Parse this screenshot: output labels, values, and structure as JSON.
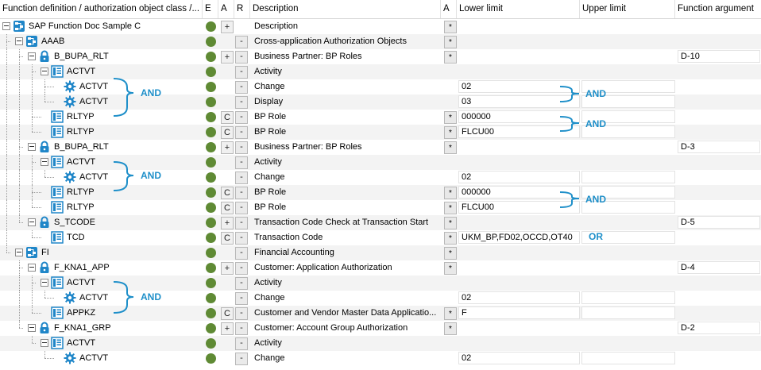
{
  "columns": {
    "function_definition": "Function definition / authorization object class /...",
    "e": "E",
    "a": "A",
    "r": "R",
    "description": "Description",
    "a2": "A",
    "lower_limit": "Lower limit",
    "upper_limit": "Upper limit",
    "function_argument": "Function argument"
  },
  "rows": [
    {
      "label": "SAP Function Doc Sample C",
      "icon": "function-doc-icon",
      "level": 0,
      "expand": true,
      "a": "+",
      "r": "",
      "desc": "Description",
      "star": true,
      "lower": null,
      "upper": null,
      "farg": null
    },
    {
      "label": "AAAB",
      "icon": "object-class-icon",
      "level": 1,
      "expand": true,
      "a": "",
      "r": "-",
      "desc": "Cross-application Authorization Objects",
      "star": true,
      "lower": null,
      "upper": null,
      "farg": null
    },
    {
      "label": "B_BUPA_RLT",
      "icon": "lock-icon",
      "level": 2,
      "expand": true,
      "a": "+",
      "r": "-",
      "desc": "Business Partner: BP Roles",
      "star": true,
      "lower": null,
      "upper": null,
      "farg": "D-10"
    },
    {
      "label": "ACTVT",
      "icon": "field-icon",
      "level": 3,
      "expand": true,
      "a": "",
      "r": "-",
      "desc": "Activity",
      "star": false,
      "lower": null,
      "upper": null,
      "farg": null
    },
    {
      "label": "ACTVT",
      "icon": "gear-icon",
      "level": 4,
      "expand": false,
      "a": "",
      "r": "-",
      "desc": "Change",
      "star": false,
      "lower": "02",
      "upper": "",
      "farg": null
    },
    {
      "label": "ACTVT",
      "icon": "gear-icon",
      "level": 4,
      "expand": false,
      "a": "",
      "r": "-",
      "desc": "Display",
      "star": false,
      "lower": "03",
      "upper": "",
      "farg": null
    },
    {
      "label": "RLTYP",
      "icon": "field-icon",
      "level": 3,
      "expand": false,
      "a": "C",
      "r": "-",
      "desc": "BP Role",
      "star": true,
      "lower": "000000",
      "upper": "",
      "farg": null
    },
    {
      "label": "RLTYP",
      "icon": "field-icon",
      "level": 3,
      "expand": false,
      "a": "C",
      "r": "-",
      "desc": "BP Role",
      "star": true,
      "lower": "FLCU00",
      "upper": "",
      "farg": null
    },
    {
      "label": "B_BUPA_RLT",
      "icon": "lock-icon",
      "level": 2,
      "expand": true,
      "a": "+",
      "r": "-",
      "desc": "Business Partner: BP Roles",
      "star": true,
      "lower": null,
      "upper": null,
      "farg": "D-3"
    },
    {
      "label": "ACTVT",
      "icon": "field-icon",
      "level": 3,
      "expand": true,
      "a": "",
      "r": "-",
      "desc": "Activity",
      "star": false,
      "lower": null,
      "upper": null,
      "farg": null
    },
    {
      "label": "ACTVT",
      "icon": "gear-icon",
      "level": 4,
      "expand": false,
      "a": "",
      "r": "-",
      "desc": "Change",
      "star": false,
      "lower": "02",
      "upper": "",
      "farg": null
    },
    {
      "label": "RLTYP",
      "icon": "field-icon",
      "level": 3,
      "expand": false,
      "a": "C",
      "r": "-",
      "desc": "BP Role",
      "star": true,
      "lower": "000000",
      "upper": "",
      "farg": null
    },
    {
      "label": "RLTYP",
      "icon": "field-icon",
      "level": 3,
      "expand": false,
      "a": "C",
      "r": "-",
      "desc": "BP Role",
      "star": true,
      "lower": "FLCU00",
      "upper": "",
      "farg": null
    },
    {
      "label": "S_TCODE",
      "icon": "lock-icon",
      "level": 2,
      "expand": true,
      "a": "+",
      "r": "-",
      "desc": "Transaction Code Check at Transaction Start",
      "star": true,
      "lower": null,
      "upper": null,
      "farg": "D-5"
    },
    {
      "label": "TCD",
      "icon": "field-icon",
      "level": 3,
      "expand": false,
      "a": "C",
      "r": "-",
      "desc": "Transaction Code",
      "star": true,
      "lower": "UKM_BP,FD02,OCCD,OT40",
      "upper": "",
      "farg": null
    },
    {
      "label": "FI",
      "icon": "object-class-icon",
      "level": 1,
      "expand": true,
      "a": "",
      "r": "-",
      "desc": "Financial Accounting",
      "star": true,
      "lower": null,
      "upper": null,
      "farg": null
    },
    {
      "label": "F_KNA1_APP",
      "icon": "lock-icon",
      "level": 2,
      "expand": true,
      "a": "+",
      "r": "-",
      "desc": "Customer: Application Authorization",
      "star": true,
      "lower": null,
      "upper": null,
      "farg": "D-4"
    },
    {
      "label": "ACTVT",
      "icon": "field-icon",
      "level": 3,
      "expand": true,
      "a": "",
      "r": "-",
      "desc": "Activity",
      "star": false,
      "lower": null,
      "upper": null,
      "farg": null
    },
    {
      "label": "ACTVT",
      "icon": "gear-icon",
      "level": 4,
      "expand": false,
      "a": "",
      "r": "-",
      "desc": "Change",
      "star": false,
      "lower": "02",
      "upper": "",
      "farg": null
    },
    {
      "label": "APPKZ",
      "icon": "field-icon",
      "level": 3,
      "expand": false,
      "a": "C",
      "r": "-",
      "desc": "Customer and Vendor Master Data Applicatio...",
      "star": true,
      "lower": "F",
      "upper": "",
      "farg": null
    },
    {
      "label": "F_KNA1_GRP",
      "icon": "lock-icon",
      "level": 2,
      "expand": true,
      "a": "+",
      "r": "-",
      "desc": "Customer: Account Group Authorization",
      "star": true,
      "lower": null,
      "upper": null,
      "farg": "D-2"
    },
    {
      "label": "ACTVT",
      "icon": "field-icon",
      "level": 3,
      "expand": true,
      "a": "",
      "r": "-",
      "desc": "Activity",
      "star": false,
      "lower": null,
      "upper": null,
      "farg": null
    },
    {
      "label": "ACTVT",
      "icon": "gear-icon",
      "level": 4,
      "expand": false,
      "a": "",
      "r": "-",
      "desc": "Change",
      "star": false,
      "lower": "02",
      "upper": "",
      "farg": null
    }
  ],
  "star_symbol": "*",
  "annotations": {
    "and_label": "AND",
    "or_label": "OR",
    "color": "#1e8fc9"
  },
  "colors": {
    "status_green": "#5f8a34",
    "icon_blue": "#1f86c8",
    "row_alt": "#f3f3f3"
  }
}
